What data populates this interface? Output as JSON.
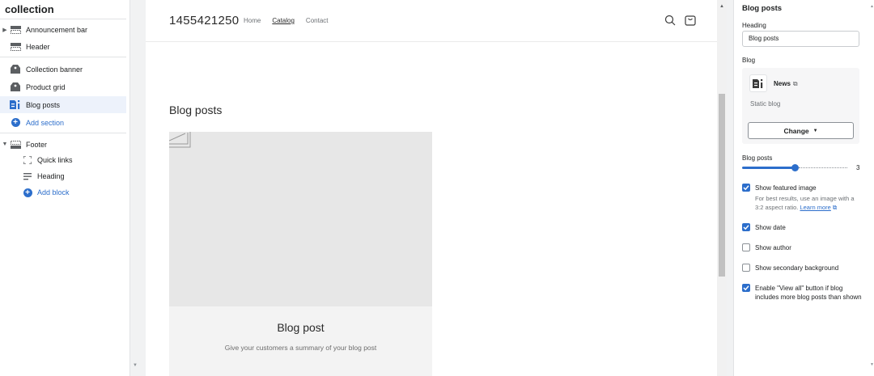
{
  "left_panel": {
    "title": "collection",
    "sections": [
      {
        "label": "Announcement bar",
        "icon": "announcement-bar-icon",
        "expandable": true
      },
      {
        "label": "Header",
        "icon": "header-layout-icon"
      },
      {
        "label": "Collection banner",
        "icon": "collection-banner-icon"
      },
      {
        "label": "Product grid",
        "icon": "product-grid-icon"
      },
      {
        "label": "Blog posts",
        "icon": "blog-posts-icon",
        "active": true
      },
      {
        "label": "Add section",
        "icon": "plus-circle-icon"
      }
    ],
    "footer": {
      "label": "Footer",
      "icon": "footer-layout-icon",
      "blocks": [
        {
          "label": "Quick links",
          "icon": "quick-links-icon"
        },
        {
          "label": "Heading",
          "icon": "heading-icon"
        },
        {
          "label": "Add block",
          "icon": "plus-circle-icon"
        }
      ]
    }
  },
  "preview": {
    "store_name": "1455421250",
    "nav": [
      {
        "label": "Home",
        "current": false
      },
      {
        "label": "Catalog",
        "current": true
      },
      {
        "label": "Contact",
        "current": false
      }
    ],
    "icons": [
      "search-icon",
      "cart-icon"
    ],
    "blog_heading": "Blog posts",
    "card": {
      "title": "Blog post",
      "description": "Give your customers a summary of your blog post"
    }
  },
  "settings": {
    "title": "Blog posts",
    "heading_label": "Heading",
    "heading_value": "Blog posts",
    "blog_label": "Blog",
    "blog_name": "News",
    "blog_type": "Static blog",
    "change_label": "Change",
    "posts_label": "Blog posts",
    "posts_value": "3",
    "posts_min": 2,
    "posts_max": 4,
    "checkboxes": [
      {
        "label": "Show featured image",
        "checked": true
      },
      {
        "label": "Show date",
        "checked": true
      },
      {
        "label": "Show author",
        "checked": false
      },
      {
        "label": "Show secondary background",
        "checked": false
      },
      {
        "label": "Enable \"View all\" button if blog includes more blog posts than shown",
        "checked": true
      }
    ],
    "featured_help": "For best results, use an image with a 3:2 aspect ratio.",
    "learn_more": "Learn more",
    "accent_color": "#2c6ecb"
  }
}
